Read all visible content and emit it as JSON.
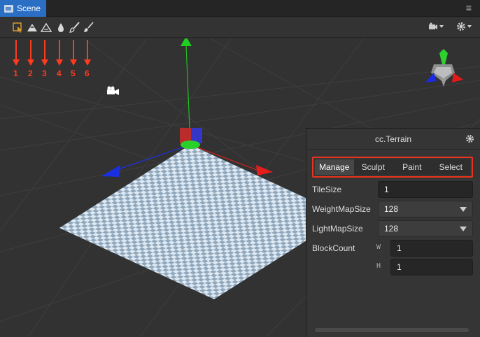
{
  "window": {
    "tab_title": "Scene",
    "menu_glyph": "≡"
  },
  "toolbar": {
    "tools": [
      {
        "icon": "terrain-select-icon",
        "number": "1"
      },
      {
        "icon": "terrain-raise-icon",
        "number": "2"
      },
      {
        "icon": "terrain-lower-icon",
        "number": "3"
      },
      {
        "icon": "terrain-smooth-icon",
        "number": "4"
      },
      {
        "icon": "terrain-paint-brush-icon",
        "number": "5"
      },
      {
        "icon": "terrain-brush-icon",
        "number": "6"
      }
    ],
    "right": [
      "camera-dropdown-icon",
      "settings-dropdown-icon"
    ]
  },
  "colors": {
    "accent": "#2b6fc4",
    "annotation": "#e8341c",
    "axis_x": "#e02020",
    "axis_y": "#20c020",
    "axis_z": "#2030e0"
  },
  "panel": {
    "title": "cc.Terrain",
    "tabs": [
      {
        "label": "Manage",
        "active": true
      },
      {
        "label": "Sculpt",
        "active": false
      },
      {
        "label": "Paint",
        "active": false
      },
      {
        "label": "Select",
        "active": false
      }
    ],
    "tile_size": {
      "label": "TileSize",
      "value": "1"
    },
    "weight_map_size": {
      "label": "WeightMapSize",
      "value": "128"
    },
    "light_map_size": {
      "label": "LightMapSize",
      "value": "128"
    },
    "block_count": {
      "label": "BlockCount",
      "w_label": "W",
      "w_value": "1",
      "h_label": "H",
      "h_value": "1"
    }
  }
}
